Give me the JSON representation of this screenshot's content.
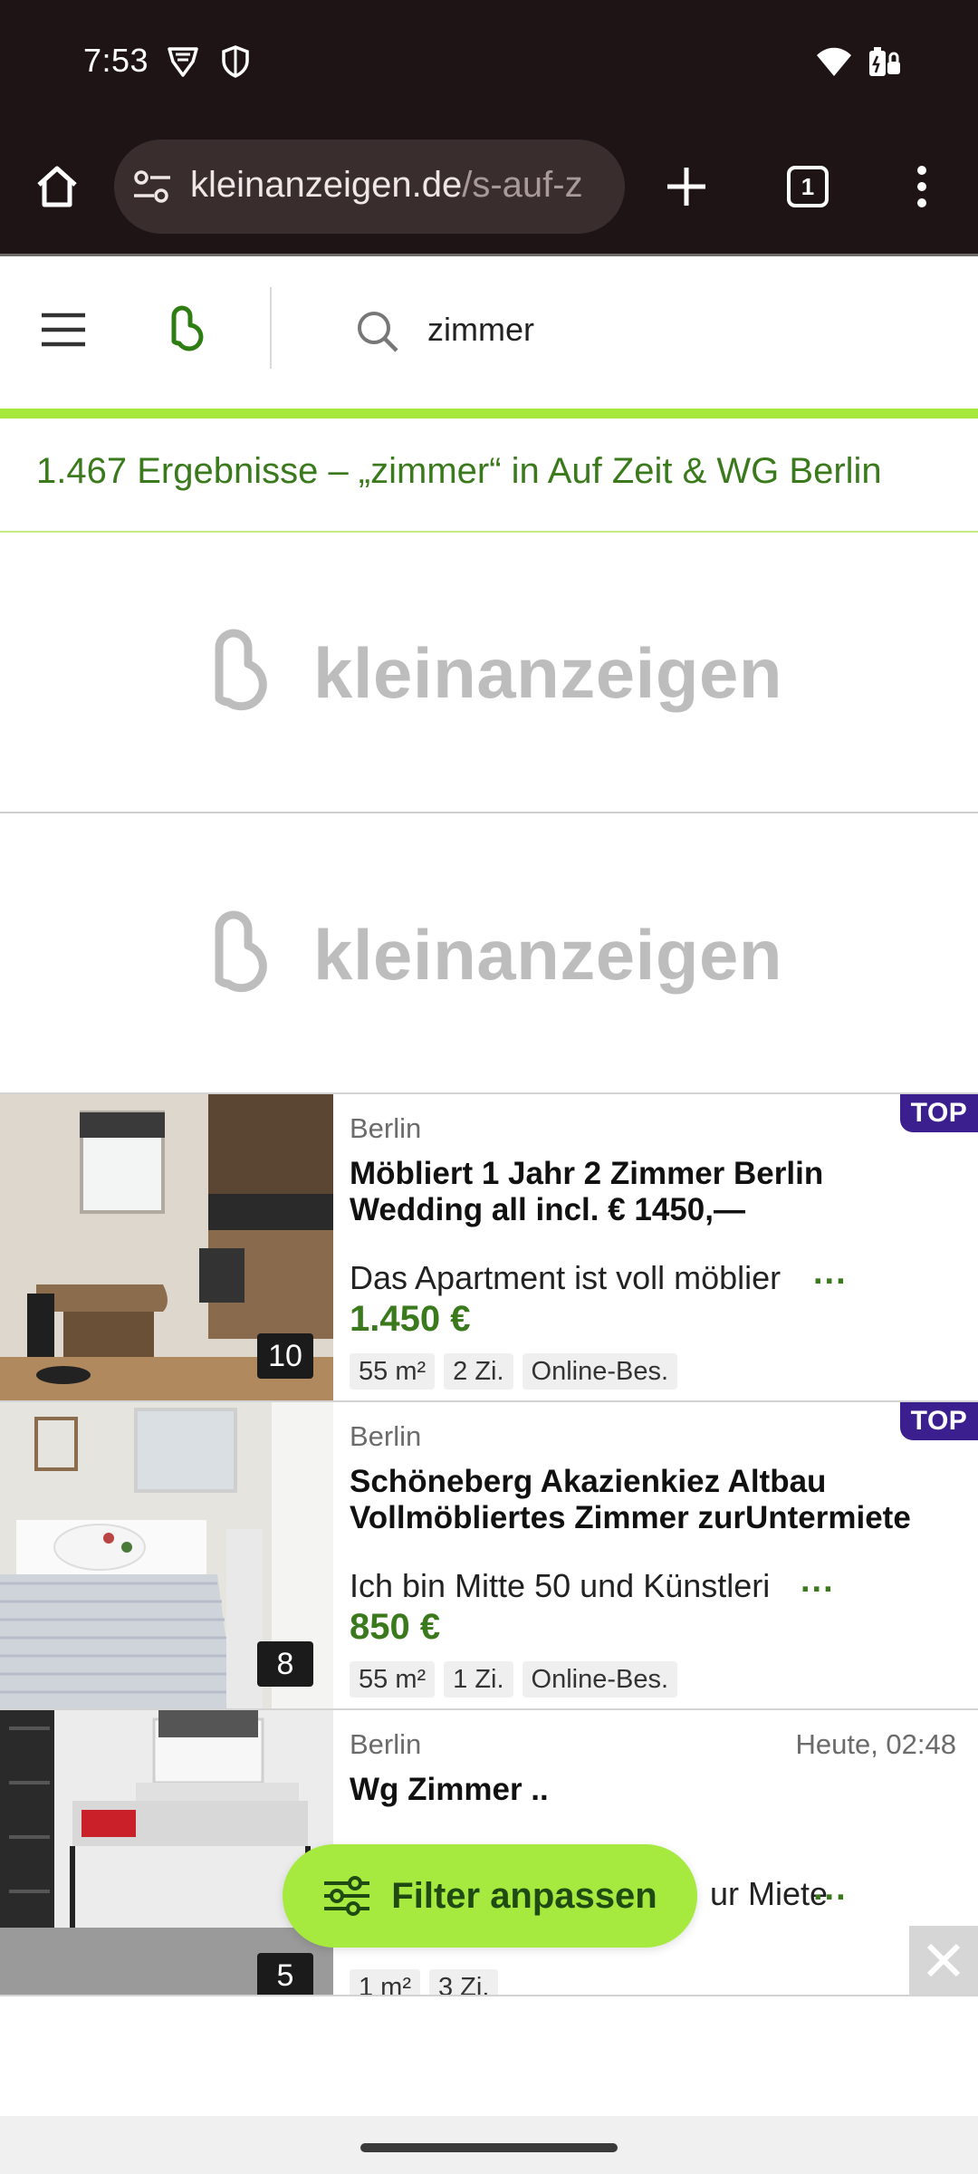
{
  "status_bar": {
    "time": "7:53",
    "icons": [
      "vpn-shield-icon",
      "shield-icon",
      "wifi-icon",
      "battery-icon"
    ]
  },
  "browser": {
    "url_host": "kleinanzeigen.de",
    "url_path": "/s-auf-z",
    "tab_count": "1",
    "icons": [
      "home-icon",
      "site-settings-icon",
      "new-tab-plus-icon",
      "tab-switcher-icon",
      "more-vert-icon"
    ]
  },
  "header": {
    "search_value": "zimmer",
    "icons": [
      "menu-icon",
      "kleinanzeigen-logo-icon",
      "search-icon"
    ]
  },
  "results": {
    "heading": "1.467 Ergebnisse – „zimmer“ in Auf Zeit & WG Berlin"
  },
  "ads": {
    "brand": "kleinanzeigen"
  },
  "listings": [
    {
      "location": "Berlin",
      "badge": "TOP",
      "date": "",
      "title": "Möbliert 1 Jahr 2 Zimmer Berlin Wedding all incl. € 1450,—",
      "description": "Das Apartment ist voll möblier",
      "more": "...",
      "price": "1.450 €",
      "image_count": "10",
      "tags": [
        "55 m²",
        "2 Zi.",
        "Online-Bes."
      ]
    },
    {
      "location": "Berlin",
      "badge": "TOP",
      "date": "",
      "title": "Schöneberg Akazienkiez Altbau Vollmöbliertes Zimmer zurUntermiete",
      "description": "Ich bin Mitte 50 und Künstleri",
      "more": "...",
      "price": "850 €",
      "image_count": "8",
      "tags": [
        "55 m²",
        "1 Zi.",
        "Online-Bes."
      ]
    },
    {
      "location": "Berlin",
      "badge": "",
      "date": "Heute, 02:48",
      "title": "Wg Zimmer ..",
      "description": "ur Miete",
      "more": "...",
      "price": "",
      "image_count": "5",
      "tags": [
        "1 m²",
        "3 Zi."
      ]
    }
  ],
  "filter_button": {
    "label": "Filter anpassen",
    "icon": "sliders-icon"
  },
  "ad_close": {
    "icon": "close-icon"
  },
  "colors": {
    "status_bg": "#1f1415",
    "brand_green": "#3a7a1c",
    "accent_lime": "#a7e83c",
    "top_badge": "#3c1f8f"
  }
}
